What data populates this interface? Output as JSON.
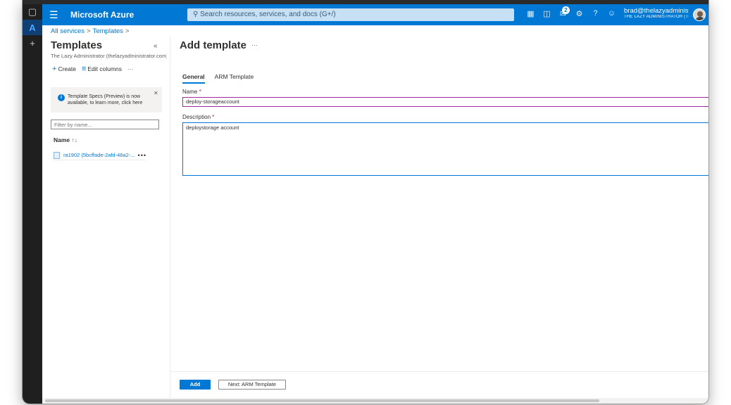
{
  "topbar": {
    "menu_icon": "hamburger-icon",
    "brand": "Microsoft Azure",
    "search_placeholder": "Search resources, services, and docs (G+/)",
    "icons": [
      "cloud-shell-icon",
      "directory-filter-icon",
      "notifications-icon",
      "settings-icon",
      "help-icon",
      "feedback-icon"
    ],
    "notification_count": "2",
    "account_name": "brad@thelazyadministr...",
    "account_org": "THE LAZY ADMINISTRATOR (THE..."
  },
  "rail": {
    "icons": [
      "tab-actions-icon",
      "azure-logo-icon",
      "add-icon"
    ]
  },
  "breadcrumb": {
    "items": [
      "All services",
      "Templates"
    ]
  },
  "left_panel": {
    "title": "Templates",
    "subtitle": "The Lazy Administrator (thelazyadministrator.com)...",
    "commands": {
      "create": "Create",
      "edit_columns": "Edit columns"
    },
    "notice_text": "Template Specs (Preview) is now available, to learn more, click here",
    "filter_placeholder": "Filter by name...",
    "column_header": "Name",
    "rows": [
      "ra1902 (5bcffade-2afd-48a2-..."
    ]
  },
  "main": {
    "title": "Add template",
    "tabs": [
      "General",
      "ARM Template"
    ],
    "name_label": "Name",
    "name_value": "deploy-storageaccount",
    "description_label": "Description",
    "description_value": "deploystorage account",
    "required_marker": "*"
  },
  "footer": {
    "add_label": "Add",
    "next_label": "Next: ARM Template"
  },
  "colors": {
    "azure_blue": "#0078d4",
    "name_border": "#a12aa0",
    "required": "#a4262c"
  }
}
